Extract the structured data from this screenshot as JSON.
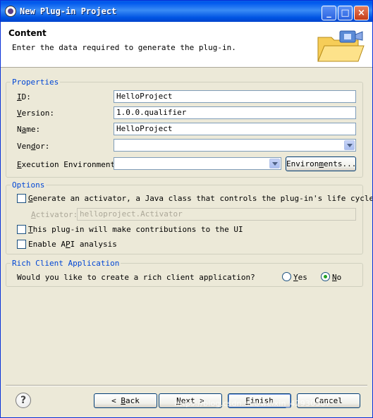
{
  "window": {
    "title": "New Plug-in Project"
  },
  "header": {
    "title": "Content",
    "message": "Enter the data required to generate the plug-in."
  },
  "properties": {
    "group_label": "Properties",
    "id": {
      "label_mnemonic": "I",
      "label_rest": "D:",
      "value": "HelloProject"
    },
    "version": {
      "label_mnemonic": "V",
      "label_rest": "ersion:",
      "value": "1.0.0.qualifier"
    },
    "name": {
      "label_pre": "N",
      "label_mnemonic": "a",
      "label_rest": "me:",
      "value": "HelloProject"
    },
    "vendor": {
      "label_pre": "Ven",
      "label_mnemonic": "d",
      "label_rest": "or:",
      "value": ""
    },
    "exec_env": {
      "label_mnemonic": "E",
      "label_rest": "xecution Environment:",
      "value": "",
      "button_pre": "Environ",
      "button_mnemonic": "m",
      "button_rest": "ents..."
    }
  },
  "options": {
    "group_label": "Options",
    "activator_check": {
      "pre": "",
      "mnemonic": "G",
      "rest": "enerate an activator, a Java class that controls the plug-in's life cycle",
      "checked": false
    },
    "activator_field": {
      "label_pre": "",
      "label_mnemonic": "A",
      "label_rest": "ctivator:",
      "value": "helloproject.Activator"
    },
    "ui_check": {
      "pre": "",
      "mnemonic": "T",
      "rest": "his plug-in will make contributions to the UI",
      "checked": false
    },
    "api_check": {
      "pre": "Enable A",
      "mnemonic": "P",
      "rest": "I analysis",
      "checked": false
    }
  },
  "rcp": {
    "group_label": "Rich Client Application",
    "question": "Would you like to create a rich client application?",
    "yes": {
      "mnemonic": "Y",
      "rest": "es",
      "selected": false
    },
    "no": {
      "mnemonic": "N",
      "rest": "o",
      "selected": true
    }
  },
  "buttons": {
    "back": {
      "pre": "< ",
      "mnemonic": "B",
      "rest": "ack"
    },
    "next": {
      "pre": "",
      "mnemonic": "N",
      "rest": "ext >"
    },
    "finish": {
      "pre": "",
      "mnemonic": "F",
      "rest": "inish"
    },
    "cancel": "Cancel",
    "help": "?"
  },
  "watermark": "https://blog.csdn.net/weixin_42930507",
  "colors": {
    "title_bar": "#0058ee",
    "group_label": "#0046d5",
    "dialog_bg": "#ece9d8"
  }
}
